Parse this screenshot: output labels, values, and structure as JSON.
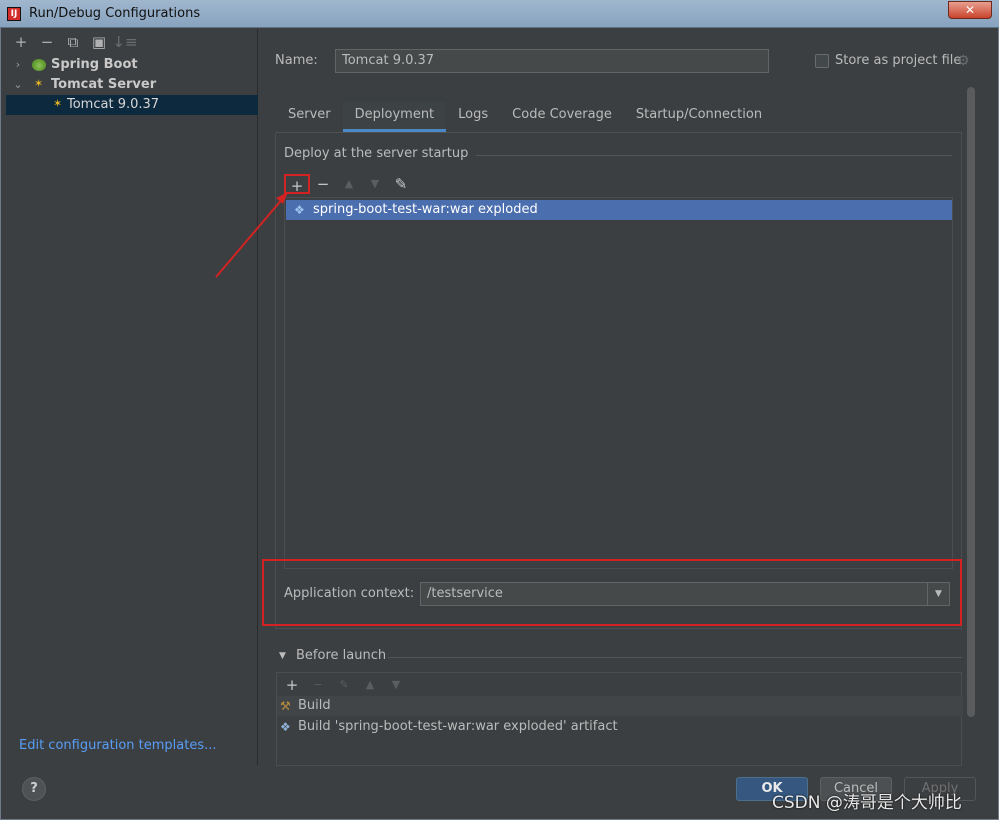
{
  "window": {
    "title": "Run/Debug Configurations",
    "close": "✕"
  },
  "left": {
    "toolbar": [
      "+",
      "−",
      "⧉",
      "▣",
      "↓≡"
    ],
    "tree": [
      {
        "label": "Spring Boot",
        "bold": true
      },
      {
        "label": "Tomcat Server",
        "bold": true
      },
      {
        "label": "Tomcat 9.0.37",
        "bold": false
      }
    ],
    "edit_templates": "Edit configuration templates..."
  },
  "config": {
    "name_label": "Name:",
    "name_value": "Tomcat 9.0.37",
    "store_label": "Store as project file"
  },
  "tabs": [
    "Server",
    "Deployment",
    "Logs",
    "Code Coverage",
    "Startup/Connection"
  ],
  "deploy": {
    "group_title": "Deploy at the server startup",
    "toolbar": [
      "+",
      "−",
      "▲",
      "▼",
      "✎"
    ],
    "items": [
      "spring-boot-test-war:war exploded"
    ],
    "context_label": "Application context:",
    "context_value": "/testservice"
  },
  "before_launch": {
    "title": "Before launch",
    "toolbar": [
      "+",
      "−",
      "✎",
      "▲",
      "▼"
    ],
    "items": [
      "Build",
      "Build 'spring-boot-test-war:war exploded' artifact"
    ]
  },
  "buttons": {
    "help": "?",
    "ok": "OK",
    "cancel": "Cancel",
    "apply": "Apply"
  },
  "watermark": "CSDN @涛哥是个大帅比",
  "colors": {
    "selection": "#4b6eaf",
    "annotation": "#d32222",
    "link": "#589df6"
  }
}
